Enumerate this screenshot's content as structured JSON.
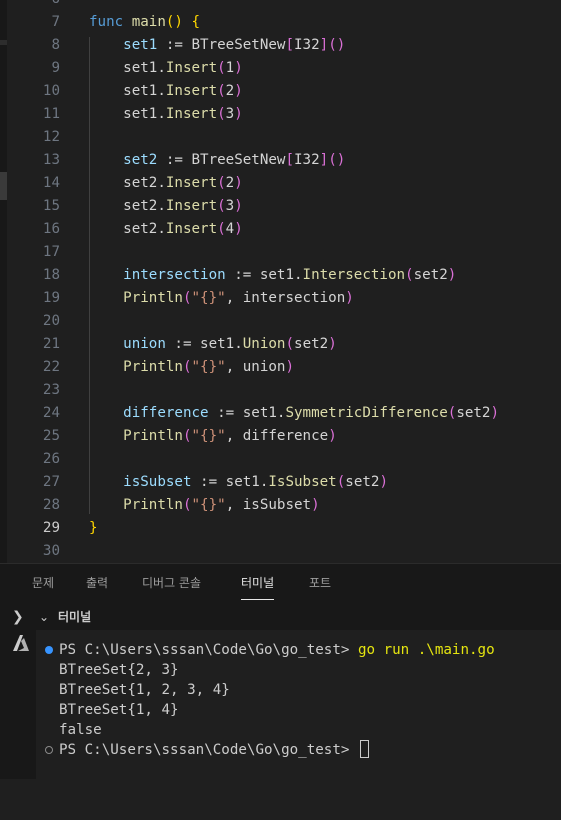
{
  "editor": {
    "first_visible_line": "6",
    "lines": [
      {
        "n": "7",
        "tokens": [
          [
            "kw",
            "func"
          ],
          [
            "ty",
            " "
          ],
          [
            "fn",
            "main"
          ],
          [
            "b1",
            "()"
          ],
          [
            "ty",
            " "
          ],
          [
            "b1",
            "{"
          ]
        ]
      },
      {
        "n": "8",
        "tokens": [
          [
            "ty",
            "    "
          ],
          [
            "vr",
            "set1"
          ],
          [
            "ty",
            " := BTreeSetNew"
          ],
          [
            "b2",
            "["
          ],
          [
            "ty",
            "I32"
          ],
          [
            "b2",
            "]"
          ],
          [
            "b2",
            "()"
          ]
        ]
      },
      {
        "n": "9",
        "tokens": [
          [
            "ty",
            "    set1."
          ],
          [
            "fn",
            "Insert"
          ],
          [
            "b2",
            "("
          ],
          [
            "ty",
            "1"
          ],
          [
            "b2",
            ")"
          ]
        ]
      },
      {
        "n": "10",
        "tokens": [
          [
            "ty",
            "    set1."
          ],
          [
            "fn",
            "Insert"
          ],
          [
            "b2",
            "("
          ],
          [
            "ty",
            "2"
          ],
          [
            "b2",
            ")"
          ]
        ]
      },
      {
        "n": "11",
        "tokens": [
          [
            "ty",
            "    set1."
          ],
          [
            "fn",
            "Insert"
          ],
          [
            "b2",
            "("
          ],
          [
            "ty",
            "3"
          ],
          [
            "b2",
            ")"
          ]
        ]
      },
      {
        "n": "12",
        "tokens": []
      },
      {
        "n": "13",
        "tokens": [
          [
            "ty",
            "    "
          ],
          [
            "vr",
            "set2"
          ],
          [
            "ty",
            " := BTreeSetNew"
          ],
          [
            "b2",
            "["
          ],
          [
            "ty",
            "I32"
          ],
          [
            "b2",
            "]"
          ],
          [
            "b2",
            "()"
          ]
        ]
      },
      {
        "n": "14",
        "tokens": [
          [
            "ty",
            "    set2."
          ],
          [
            "fn",
            "Insert"
          ],
          [
            "b2",
            "("
          ],
          [
            "ty",
            "2"
          ],
          [
            "b2",
            ")"
          ]
        ]
      },
      {
        "n": "15",
        "tokens": [
          [
            "ty",
            "    set2."
          ],
          [
            "fn",
            "Insert"
          ],
          [
            "b2",
            "("
          ],
          [
            "ty",
            "3"
          ],
          [
            "b2",
            ")"
          ]
        ]
      },
      {
        "n": "16",
        "tokens": [
          [
            "ty",
            "    set2."
          ],
          [
            "fn",
            "Insert"
          ],
          [
            "b2",
            "("
          ],
          [
            "ty",
            "4"
          ],
          [
            "b2",
            ")"
          ]
        ]
      },
      {
        "n": "17",
        "tokens": []
      },
      {
        "n": "18",
        "tokens": [
          [
            "ty",
            "    "
          ],
          [
            "vr",
            "intersection"
          ],
          [
            "ty",
            " := set1."
          ],
          [
            "fn",
            "Intersection"
          ],
          [
            "b2",
            "("
          ],
          [
            "ty",
            "set2"
          ],
          [
            "b2",
            ")"
          ]
        ]
      },
      {
        "n": "19",
        "tokens": [
          [
            "ty",
            "    "
          ],
          [
            "fn",
            "Println"
          ],
          [
            "b2",
            "("
          ],
          [
            "st",
            "\"{}\""
          ],
          [
            "ty",
            ", intersection"
          ],
          [
            "b2",
            ")"
          ]
        ]
      },
      {
        "n": "20",
        "tokens": []
      },
      {
        "n": "21",
        "tokens": [
          [
            "ty",
            "    "
          ],
          [
            "vr",
            "union"
          ],
          [
            "ty",
            " := set1."
          ],
          [
            "fn",
            "Union"
          ],
          [
            "b2",
            "("
          ],
          [
            "ty",
            "set2"
          ],
          [
            "b2",
            ")"
          ]
        ]
      },
      {
        "n": "22",
        "tokens": [
          [
            "ty",
            "    "
          ],
          [
            "fn",
            "Println"
          ],
          [
            "b2",
            "("
          ],
          [
            "st",
            "\"{}\""
          ],
          [
            "ty",
            ", union"
          ],
          [
            "b2",
            ")"
          ]
        ]
      },
      {
        "n": "23",
        "tokens": []
      },
      {
        "n": "24",
        "tokens": [
          [
            "ty",
            "    "
          ],
          [
            "vr",
            "difference"
          ],
          [
            "ty",
            " := set1."
          ],
          [
            "fn",
            "SymmetricDifference"
          ],
          [
            "b2",
            "("
          ],
          [
            "ty",
            "set2"
          ],
          [
            "b2",
            ")"
          ]
        ]
      },
      {
        "n": "25",
        "tokens": [
          [
            "ty",
            "    "
          ],
          [
            "fn",
            "Println"
          ],
          [
            "b2",
            "("
          ],
          [
            "st",
            "\"{}\""
          ],
          [
            "ty",
            ", difference"
          ],
          [
            "b2",
            ")"
          ]
        ]
      },
      {
        "n": "26",
        "tokens": []
      },
      {
        "n": "27",
        "tokens": [
          [
            "ty",
            "    "
          ],
          [
            "vr",
            "isSubset"
          ],
          [
            "ty",
            " := set1."
          ],
          [
            "fn",
            "IsSubset"
          ],
          [
            "b2",
            "("
          ],
          [
            "ty",
            "set2"
          ],
          [
            "b2",
            ")"
          ]
        ]
      },
      {
        "n": "28",
        "tokens": [
          [
            "ty",
            "    "
          ],
          [
            "fn",
            "Println"
          ],
          [
            "b2",
            "("
          ],
          [
            "st",
            "\"{}\""
          ],
          [
            "ty",
            ", isSubset"
          ],
          [
            "b2",
            ")"
          ]
        ]
      },
      {
        "n": "29",
        "tokens": [
          [
            "b1",
            "}"
          ]
        ],
        "active": true
      },
      {
        "n": "30",
        "tokens": []
      }
    ]
  },
  "panel": {
    "tabs": [
      {
        "label": "문제",
        "active": false
      },
      {
        "label": "출력",
        "active": false
      },
      {
        "label": "디버그 콘솔",
        "active": false
      },
      {
        "label": "터미널",
        "active": true
      },
      {
        "label": "포트",
        "active": false
      }
    ],
    "terminal_title": "터미널",
    "chevron_right": "❯",
    "chevron_down": "⌄",
    "prompt": "PS C:\\Users\\sssan\\Code\\Go\\go_test> ",
    "command": "go run .\\main.go",
    "output": [
      "BTreeSet{2, 3}",
      "BTreeSet{1, 2, 3, 4}",
      "BTreeSet{1, 4}",
      "false"
    ],
    "prompt2": "PS C:\\Users\\sssan\\Code\\Go\\go_test> "
  },
  "icons": {
    "terminal_profile": "azure-icon",
    "decoration_success": "blue-dot",
    "decoration_empty": "hollow-dot"
  }
}
